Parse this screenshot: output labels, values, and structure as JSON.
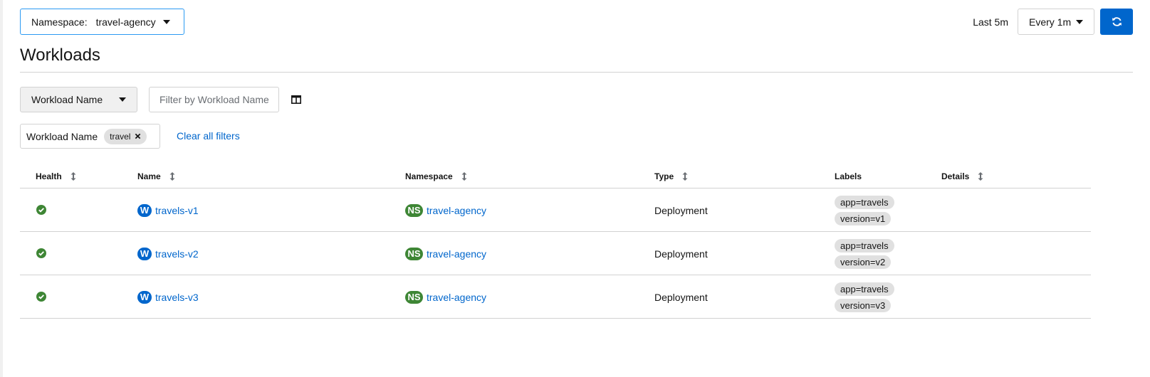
{
  "namespace_selector": {
    "prefix": "Namespace:",
    "value": "travel-agency"
  },
  "refresh": {
    "last_label": "Last 5m",
    "interval_label": "Every 1m"
  },
  "page": {
    "title": "Workloads"
  },
  "filter": {
    "type_label": "Workload Name",
    "placeholder": "Filter by Workload Name"
  },
  "active_filters": {
    "category": "Workload Name",
    "chip": "travel",
    "clear_label": "Clear all filters"
  },
  "table": {
    "headers": {
      "health": "Health",
      "name": "Name",
      "namespace": "Namespace",
      "type": "Type",
      "labels": "Labels",
      "details": "Details"
    },
    "rows": [
      {
        "health": "healthy",
        "badge": "W",
        "name": "travels-v1",
        "ns_badge": "NS",
        "namespace": "travel-agency",
        "type": "Deployment",
        "labels": [
          "app=travels",
          "version=v1"
        ]
      },
      {
        "health": "healthy",
        "badge": "W",
        "name": "travels-v2",
        "ns_badge": "NS",
        "namespace": "travel-agency",
        "type": "Deployment",
        "labels": [
          "app=travels",
          "version=v2"
        ]
      },
      {
        "health": "healthy",
        "badge": "W",
        "name": "travels-v3",
        "ns_badge": "NS",
        "namespace": "travel-agency",
        "type": "Deployment",
        "labels": [
          "app=travels",
          "version=v3"
        ]
      }
    ]
  },
  "colors": {
    "primary": "#0066cc",
    "healthy": "#3e8635",
    "border": "#d2d2d2",
    "chip_bg": "#e0e0e0"
  }
}
